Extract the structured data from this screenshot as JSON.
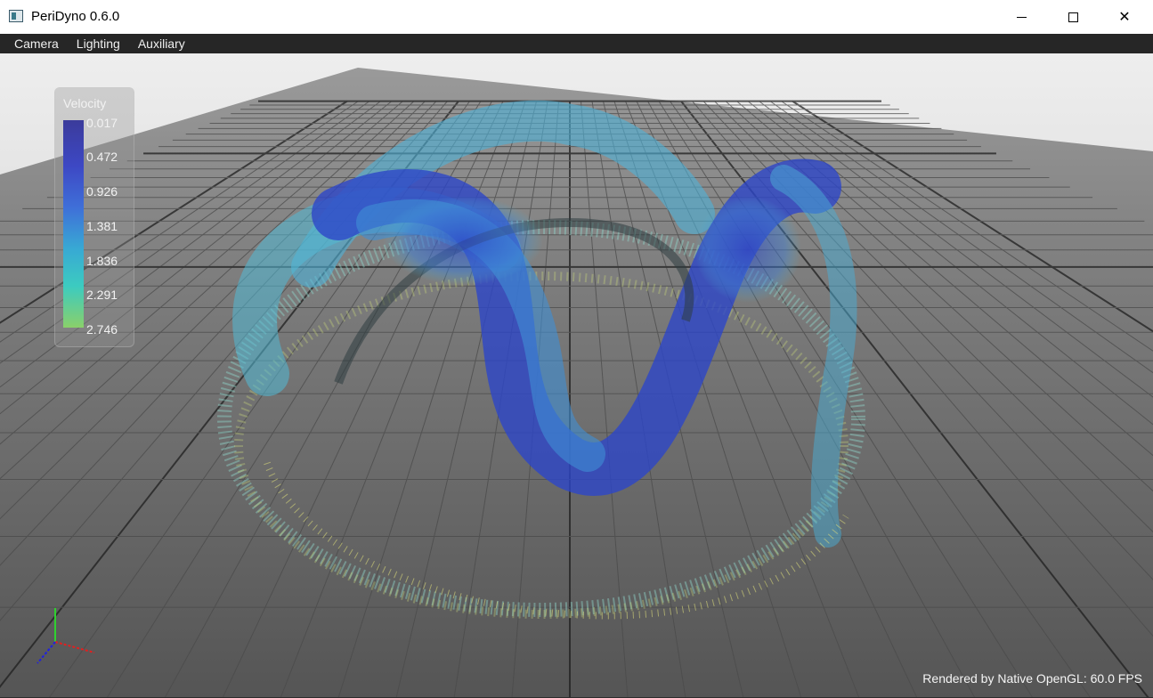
{
  "window": {
    "title": "PeriDyno 0.6.0",
    "minimize_glyph": "",
    "close_glyph": "✕"
  },
  "menu": {
    "items": [
      "Camera",
      "Lighting",
      "Auxiliary"
    ]
  },
  "colorbar": {
    "title": "Velocity",
    "ticks": [
      "0.017",
      "0.472",
      "0.926",
      "1.381",
      "1.836",
      "2.291",
      "2.746"
    ],
    "colors": [
      "#3b3b9b",
      "#3d48c4",
      "#3f6fd8",
      "#38a9d4",
      "#3ccbc0",
      "#8ad06a"
    ]
  },
  "status": {
    "render_info": "Rendered by Native OpenGL: 60.0 FPS"
  },
  "icons": {
    "app": "peridyno-app-icon",
    "minimize": "minimize-icon",
    "maximize": "maximize-icon",
    "close": "close-icon",
    "axes": "xyz-axes-gizmo-icon"
  }
}
